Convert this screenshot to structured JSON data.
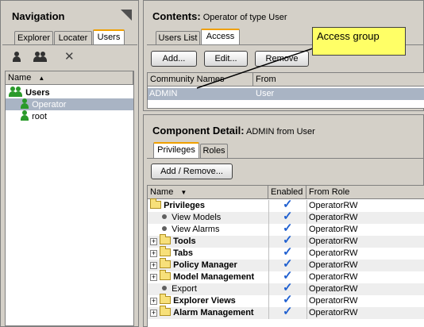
{
  "navigation": {
    "title": "Navigation",
    "tabs": [
      "Explorer",
      "Locater",
      "Users"
    ],
    "tree_header": "Name",
    "root": "Users",
    "items": [
      "Operator",
      "root"
    ]
  },
  "contents": {
    "title": "Contents:",
    "subtitle": "Operator of type User",
    "tabs": [
      "Users List",
      "Access"
    ],
    "buttons": [
      "Add...",
      "Edit...",
      "Remove"
    ],
    "columns": [
      "Community Names",
      "From"
    ],
    "rows": [
      {
        "name": "ADMIN",
        "from": "User"
      }
    ]
  },
  "callout": {
    "text": "Access group"
  },
  "detail": {
    "title": "Component Detail:",
    "subtitle": "ADMIN from User",
    "tabs": [
      "Privileges",
      "Roles"
    ],
    "button": "Add / Remove...",
    "columns": [
      "Name",
      "Enabled",
      "From Role"
    ],
    "rows": [
      {
        "name": "Privileges",
        "kind": "folder-open",
        "bold": true,
        "role": "OperatorRW"
      },
      {
        "name": "View Models",
        "kind": "leaf",
        "bold": false,
        "role": "OperatorRW"
      },
      {
        "name": "View Alarms",
        "kind": "leaf",
        "bold": false,
        "role": "OperatorRW"
      },
      {
        "name": "Tools",
        "kind": "folder",
        "bold": true,
        "role": "OperatorRW"
      },
      {
        "name": "Tabs",
        "kind": "folder",
        "bold": true,
        "role": "OperatorRW"
      },
      {
        "name": "Policy Manager",
        "kind": "folder",
        "bold": true,
        "role": "OperatorRW"
      },
      {
        "name": "Model Management",
        "kind": "folder",
        "bold": true,
        "role": "OperatorRW"
      },
      {
        "name": "Export",
        "kind": "leaf",
        "bold": false,
        "role": "OperatorRW"
      },
      {
        "name": "Explorer Views",
        "kind": "folder",
        "bold": true,
        "role": "OperatorRW"
      },
      {
        "name": "Alarm Management",
        "kind": "folder",
        "bold": true,
        "role": "OperatorRW"
      }
    ]
  },
  "colors": {
    "tab_accent": "#f0a000",
    "selection": "#a9b4c4",
    "check": "#2060d0",
    "callout": "#ffff66"
  }
}
